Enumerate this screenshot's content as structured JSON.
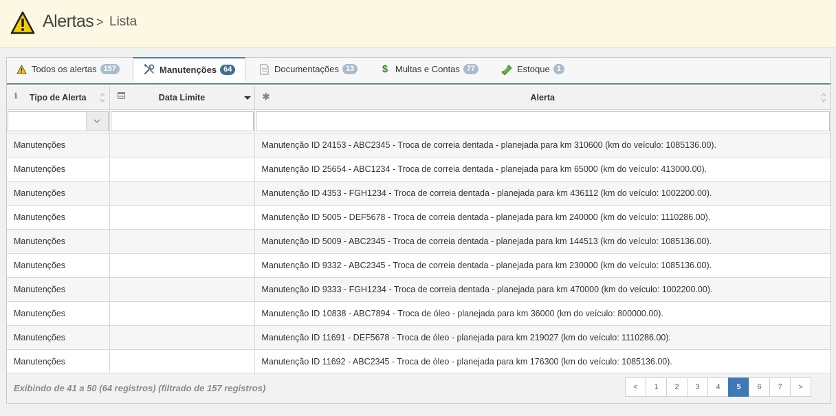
{
  "header": {
    "title": "Alertas",
    "separator": ">",
    "subtitle": "Lista"
  },
  "tabs": [
    {
      "label": "Todos os alertas",
      "count": "157",
      "icon": "warning-icon"
    },
    {
      "label": "Manutenções",
      "count": "64",
      "icon": "tools-icon",
      "active": true
    },
    {
      "label": "Documentações",
      "count": "13",
      "icon": "document-icon"
    },
    {
      "label": "Multas e Contas",
      "count": "77",
      "icon": "dollar-icon"
    },
    {
      "label": "Estoque",
      "count": "1",
      "icon": "stock-icon"
    }
  ],
  "table": {
    "columns": [
      "Tipo de Alerta",
      "Data Limite",
      "Alerta"
    ],
    "rows": [
      [
        "Manutenções",
        "",
        "Manutenção ID 24153 - ABC2345 - Troca de correia dentada - planejada para km 310600 (km do veículo: 1085136.00)."
      ],
      [
        "Manutenções",
        "",
        "Manutenção ID 25654 - ABC1234 - Troca de correia dentada - planejada para km 65000 (km do veículo: 413000.00)."
      ],
      [
        "Manutenções",
        "",
        "Manutenção ID 4353 - FGH1234 - Troca de correia dentada - planejada para km 436112 (km do veículo: 1002200.00)."
      ],
      [
        "Manutenções",
        "",
        "Manutenção ID 5005 - DEF5678 - Troca de correia dentada - planejada para km 240000 (km do veículo: 1110286.00)."
      ],
      [
        "Manutenções",
        "",
        "Manutenção ID 5009 - ABC2345 - Troca de correia dentada - planejada para km 144513 (km do veículo: 1085136.00)."
      ],
      [
        "Manutenções",
        "",
        "Manutenção ID 9332 - ABC2345 - Troca de correia dentada - planejada para km 230000 (km do veículo: 1085136.00)."
      ],
      [
        "Manutenções",
        "",
        "Manutenção ID 9333 - FGH1234 - Troca de correia dentada - planejada para km 470000 (km do veículo: 1002200.00)."
      ],
      [
        "Manutenções",
        "",
        "Manutenção ID 10838 - ABC7894 - Troca de óleo - planejada para km 36000 (km do veículo: 800000.00)."
      ],
      [
        "Manutenções",
        "",
        "Manutenção ID 11691 - DEF5678 - Troca de óleo - planejada para km 219027 (km do veículo: 1110286.00)."
      ],
      [
        "Manutenções",
        "",
        "Manutenção ID 11692 - ABC2345 - Troca de óleo - planejada para km 176300 (km do veículo: 1085136.00)."
      ]
    ]
  },
  "footer": {
    "info": "Exibindo de 41 a 50 (64 registros) (filtrado de 157 registros)",
    "pages": [
      "<",
      "1",
      "2",
      "3",
      "4",
      "5",
      "6",
      "7",
      ">"
    ],
    "current_page": "5"
  }
}
